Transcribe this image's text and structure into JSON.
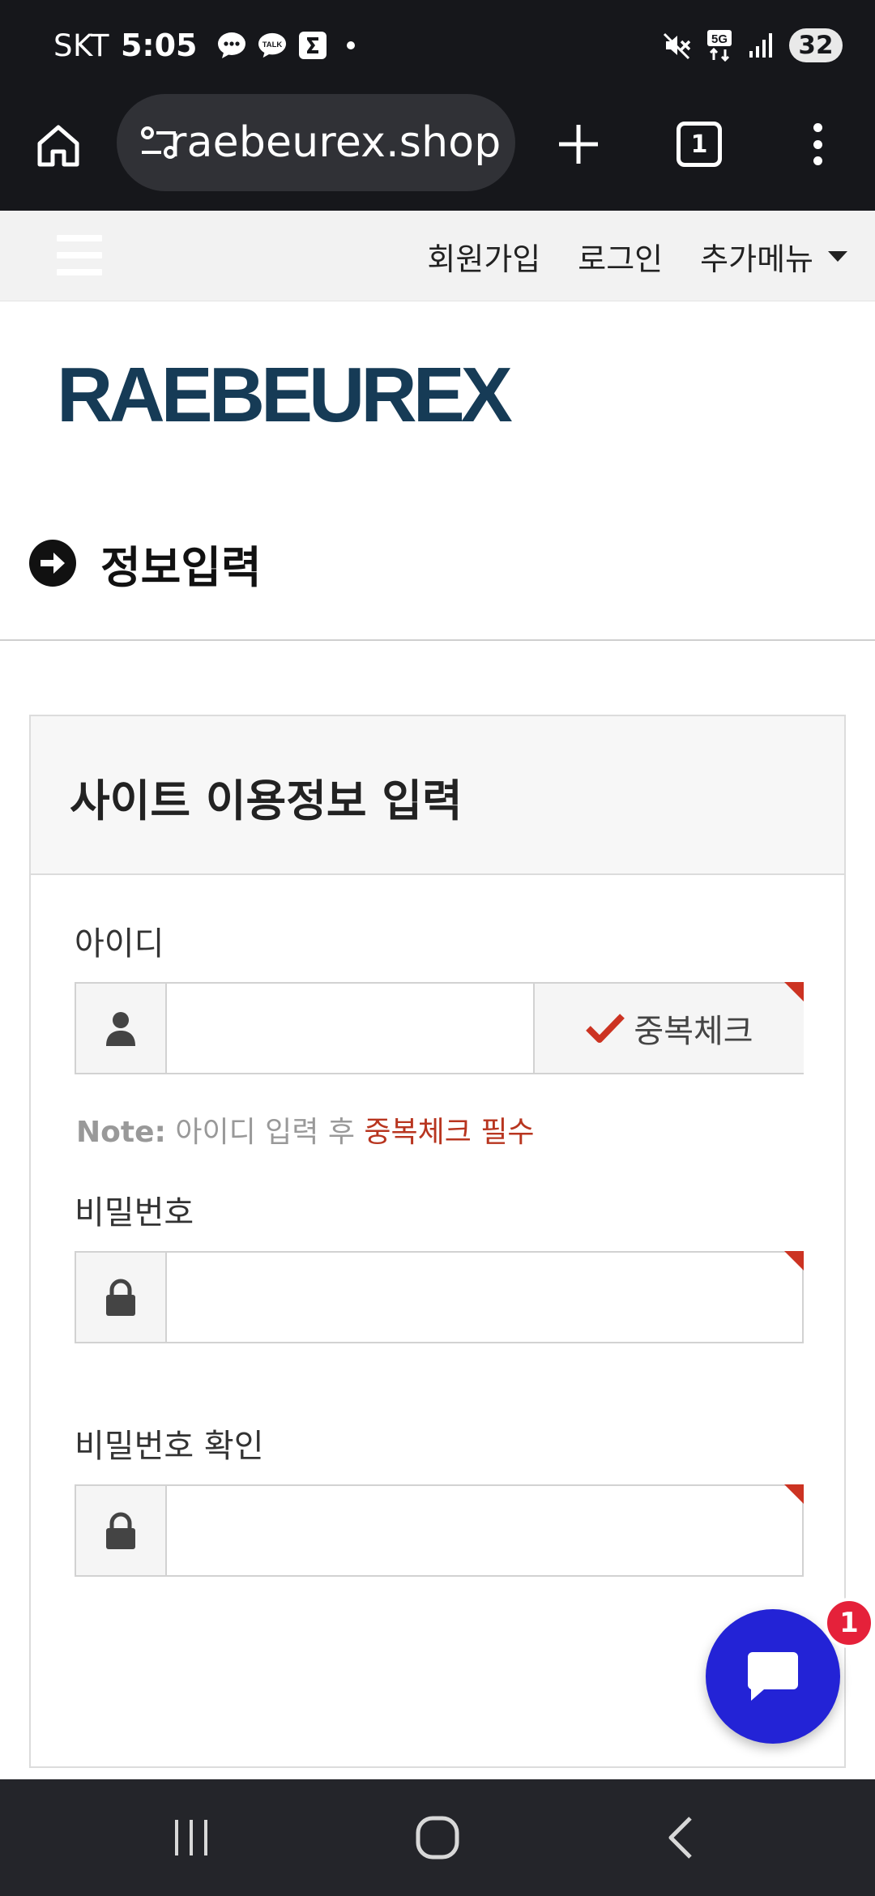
{
  "status_bar": {
    "carrier": "SKT",
    "time": "5:05",
    "talk_label": "TALK",
    "network": "5G",
    "battery": "32"
  },
  "browser": {
    "url": "raebeurex.shop",
    "tab_count": "1"
  },
  "site_nav": {
    "signup": "회원가입",
    "login": "로그인",
    "more": "추가메뉴"
  },
  "logo_text": "RAEBEUREX",
  "section_title": "정보입력",
  "form": {
    "panel_title": "사이트 이용정보 입력",
    "id_label": "아이디",
    "id_value": "",
    "dup_check_label": "중복체크",
    "note_prefix": "Note:",
    "note_text": " 아이디 입력 후 ",
    "note_emphasis": "중복체크 필수",
    "password_label": "비밀번호",
    "password_value": "",
    "password_confirm_label": "비밀번호 확인",
    "password_confirm_value": ""
  },
  "chat": {
    "badge_count": "1"
  },
  "colors": {
    "status_bg": "#16171b",
    "logo": "#163b56",
    "required_mark": "#cc3322",
    "note_accent": "#b8351f",
    "chat_button": "#2323d6",
    "chat_badge": "#e5213a"
  }
}
